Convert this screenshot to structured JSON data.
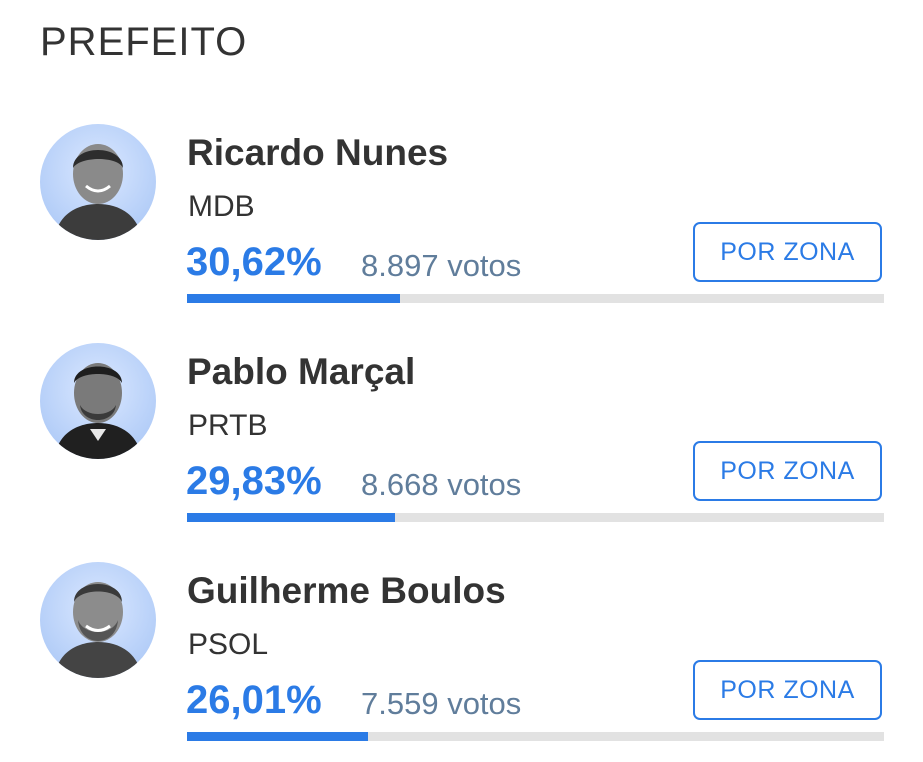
{
  "section": {
    "title": "PREFEITO"
  },
  "colors": {
    "accent": "#2b7be6",
    "votes_text": "#607d9b",
    "track": "#e2e2e2",
    "avatar_bg": "#b4cef8"
  },
  "candidates": [
    {
      "name": "Ricardo Nunes",
      "party": "MDB",
      "percent": "30,62%",
      "percent_value": 30.62,
      "votes": "8.897 votos",
      "button_label": "POR ZONA",
      "avatar_icon": "candidate-photo-icon"
    },
    {
      "name": "Pablo Marçal",
      "party": "PRTB",
      "percent": "29,83%",
      "percent_value": 29.83,
      "votes": "8.668 votos",
      "button_label": "POR ZONA",
      "avatar_icon": "candidate-photo-icon"
    },
    {
      "name": "Guilherme Boulos",
      "party": "PSOL",
      "percent": "26,01%",
      "percent_value": 26.01,
      "votes": "7.559 votos",
      "button_label": "POR ZONA",
      "avatar_icon": "candidate-photo-icon"
    }
  ]
}
